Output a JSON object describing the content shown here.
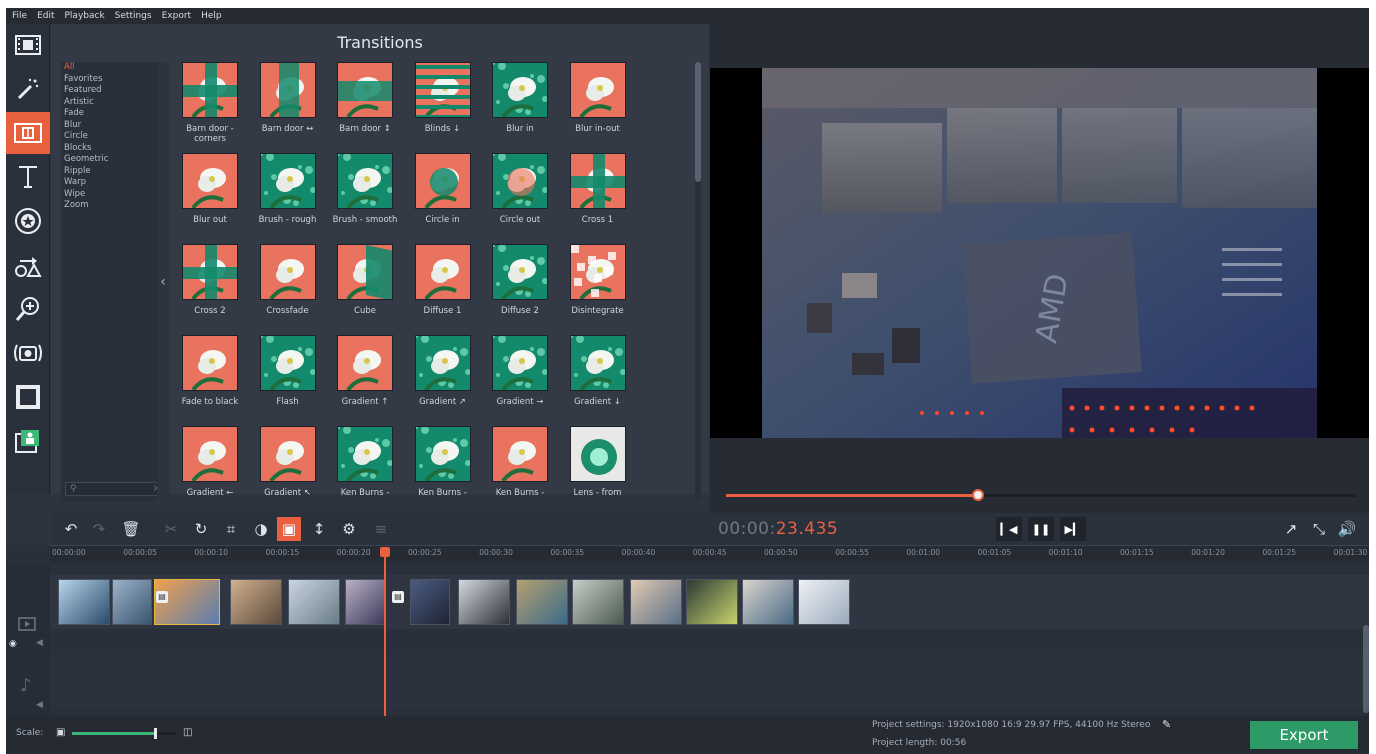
{
  "menu": [
    "File",
    "Edit",
    "Playback",
    "Settings",
    "Export",
    "Help"
  ],
  "panel_title": "Transitions",
  "categories": [
    "All",
    "Favorites",
    "Featured",
    "Artistic",
    "Fade",
    "Blur",
    "Circle",
    "Blocks",
    "Geometric",
    "Ripple",
    "Warp",
    "Wipe",
    "Zoom"
  ],
  "selected_category": "All",
  "transitions": [
    {
      "label": "Barn door - corners",
      "style": "cross"
    },
    {
      "label": "Barn door ↔",
      "style": "vsplit"
    },
    {
      "label": "Barn door ↕",
      "style": "hsplit"
    },
    {
      "label": "Blinds ↓",
      "style": "blinds"
    },
    {
      "label": "Blur in",
      "style": "green"
    },
    {
      "label": "Blur in-out",
      "style": "red"
    },
    {
      "label": "Blur out",
      "style": "red"
    },
    {
      "label": "Brush - rough",
      "style": "green"
    },
    {
      "label": "Brush - smooth",
      "style": "green"
    },
    {
      "label": "Circle in",
      "style": "circle"
    },
    {
      "label": "Circle out",
      "style": "circle2"
    },
    {
      "label": "Cross 1",
      "style": "cross"
    },
    {
      "label": "Cross 2",
      "style": "cross"
    },
    {
      "label": "Crossfade",
      "style": "red"
    },
    {
      "label": "Cube",
      "style": "cube"
    },
    {
      "label": "Diffuse 1",
      "style": "red"
    },
    {
      "label": "Diffuse 2",
      "style": "green"
    },
    {
      "label": "Disintegrate",
      "style": "blocks"
    },
    {
      "label": "Fade to black",
      "style": "red"
    },
    {
      "label": "Flash",
      "style": "green"
    },
    {
      "label": "Gradient ↑",
      "style": "red"
    },
    {
      "label": "Gradient ↗",
      "style": "green"
    },
    {
      "label": "Gradient →",
      "style": "green"
    },
    {
      "label": "Gradient ↓",
      "style": "green"
    },
    {
      "label": "Gradient ←",
      "style": "red"
    },
    {
      "label": "Gradient ↖",
      "style": "red"
    },
    {
      "label": "Ken Burns -",
      "style": "green"
    },
    {
      "label": "Ken Burns -",
      "style": "green"
    },
    {
      "label": "Ken Burns -",
      "style": "red"
    },
    {
      "label": "Lens - from",
      "style": "lens"
    }
  ],
  "edit_tools": [
    {
      "name": "undo-icon",
      "glyph": "↶",
      "dim": false
    },
    {
      "name": "redo-icon",
      "glyph": "↷",
      "dim": true
    },
    {
      "name": "delete-icon",
      "glyph": "🗑",
      "dim": false
    },
    {
      "name": "cut-icon",
      "glyph": "✂",
      "dim": true
    },
    {
      "name": "rotate-icon",
      "glyph": "↻",
      "dim": false
    },
    {
      "name": "crop-icon",
      "glyph": "⌗",
      "dim": false
    },
    {
      "name": "color-adjust-icon",
      "glyph": "◑",
      "dim": false
    },
    {
      "name": "image-icon",
      "glyph": "▣",
      "dim": false
    },
    {
      "name": "microphone-icon",
      "glyph": "↕",
      "dim": false
    },
    {
      "name": "gear-icon",
      "glyph": "⚙",
      "dim": false
    },
    {
      "name": "equalizer-icon",
      "glyph": "≡",
      "dim": true
    }
  ],
  "timecode_main": "00:00:",
  "timecode_frac": "23.435",
  "playback_progress": 0.4,
  "ruler_ticks": [
    "00:00:00",
    "00:00:05",
    "00:00:10",
    "00:00:15",
    "00:00:20",
    "00:00:25",
    "00:00:30",
    "00:00:35",
    "00:00:40",
    "00:00:45",
    "00:00:50",
    "00:00:55",
    "00:01:00",
    "00:01:05",
    "00:01:10",
    "00:01:15",
    "00:01:20",
    "00:01:25",
    "00:01:30"
  ],
  "scale_label": "Scale:",
  "scale_level": 0.8,
  "project_settings": "Project settings:  1920x1080 16:9 29.97 FPS, 44100 Hz Stereo",
  "project_length": "Project length:   00:56",
  "export_label": "Export",
  "colors": {
    "accent": "#e8603e",
    "export": "#2d9a68",
    "panel": "#333a46"
  }
}
